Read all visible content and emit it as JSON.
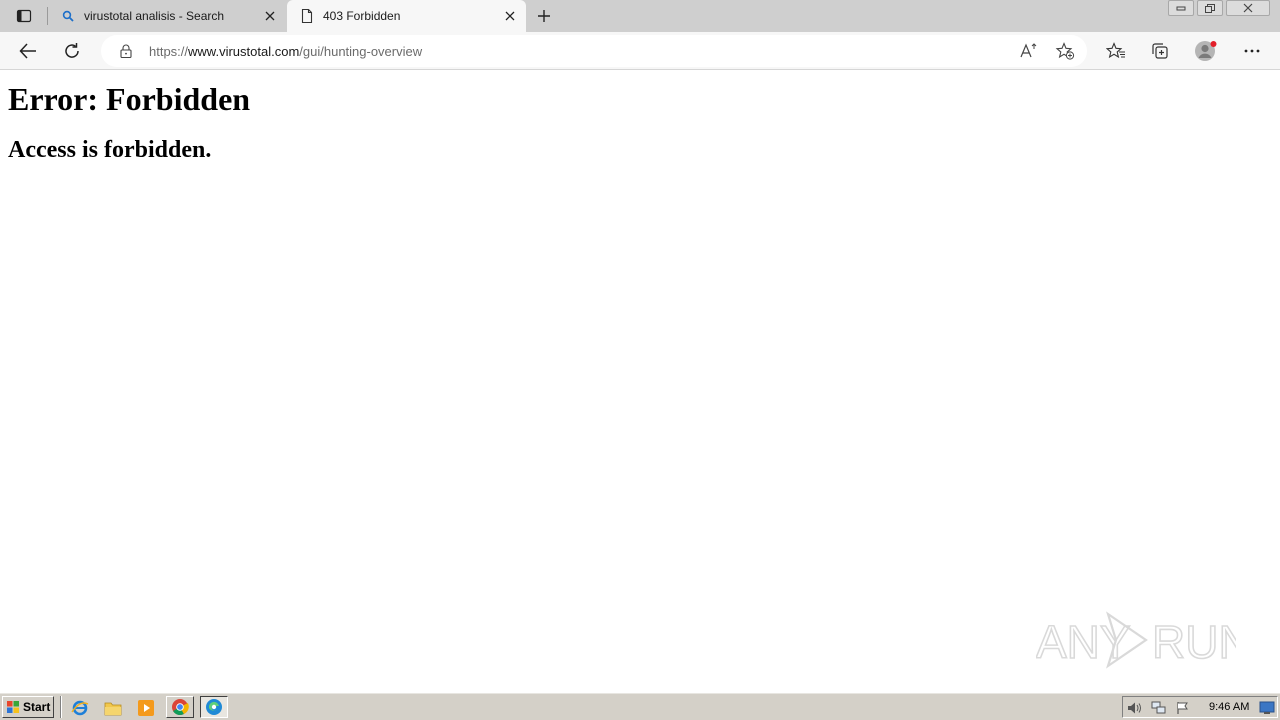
{
  "browser": {
    "tabs": [
      {
        "title": "virustotal analisis - Search",
        "icon": "search-icon",
        "active": false
      },
      {
        "title": "403 Forbidden",
        "icon": "page-icon",
        "active": true
      }
    ],
    "address_bar": {
      "url_prefix": "https://",
      "url_host": "www.virustotal.com",
      "url_path": "/gui/hunting-overview"
    },
    "toolbar_icons": [
      "back-icon",
      "refresh-icon",
      "lock-icon",
      "read-aloud-icon",
      "add-favorite-icon",
      "favorites-icon",
      "collections-icon",
      "profile-avatar",
      "more-icon"
    ]
  },
  "page": {
    "heading": "Error: Forbidden",
    "message": "Access is forbidden."
  },
  "watermark": {
    "text_left": "ANY",
    "text_right": "RUN"
  },
  "taskbar": {
    "start_label": "Start",
    "quick_launch": [
      "ie-icon",
      "explorer-icon",
      "media-player-icon"
    ],
    "tasks": [
      "chrome-icon",
      "edge-icon"
    ],
    "tray_icons": [
      "volume-icon",
      "network-icon",
      "action-center-flag-icon"
    ],
    "clock": "9:46 AM"
  },
  "colors": {
    "tabstrip": "#cfcfcf",
    "toolbar": "#f7f7f7",
    "taskbar": "#d4d0c8",
    "profile_dot": "#e3202a"
  }
}
